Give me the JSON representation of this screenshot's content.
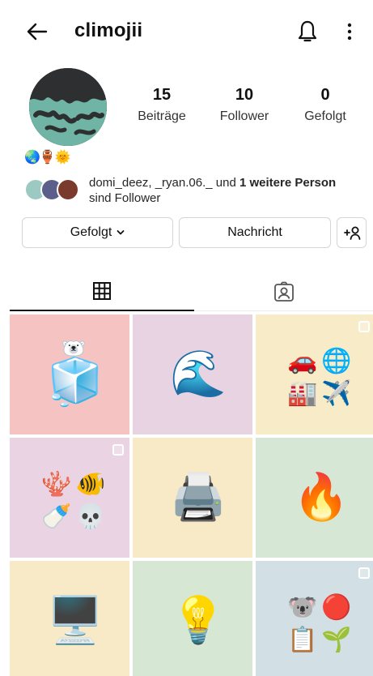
{
  "header": {
    "username": "climojii",
    "back_icon": "arrow-left-icon",
    "notification_icon": "bell-icon",
    "menu_icon": "more-vertical-icon"
  },
  "profile": {
    "stats": {
      "posts": {
        "value": "15",
        "label": "Beiträge"
      },
      "followers": {
        "value": "10",
        "label": "Follower"
      },
      "following": {
        "value": "0",
        "label": "Gefolgt"
      }
    },
    "bio": "🌏🏺🌞",
    "followed_by": {
      "names": "domi_deez, _ryan.06._",
      "connector": " und ",
      "more": "1 weitere Person",
      "suffix": "sind Follower"
    }
  },
  "actions": {
    "following_label": "Gefolgt",
    "message_label": "Nachricht",
    "add_user_icon": "person-add-icon"
  },
  "tabs": [
    {
      "name": "posts-grid",
      "icon": "grid-icon",
      "active": true
    },
    {
      "name": "tagged",
      "icon": "tagged-person-icon",
      "active": false
    }
  ],
  "posts": [
    {
      "bg": "#f6c3c3",
      "emojis": [
        "🐻‍❄️",
        "🧊"
      ],
      "multi": false
    },
    {
      "bg": "#e8d3e3",
      "emojis": [
        "🌊"
      ],
      "multi": false
    },
    {
      "bg": "#f7ebc8",
      "emojis": [
        "🚗",
        "🌐",
        "🏭",
        "✈️"
      ],
      "multi": true
    },
    {
      "bg": "#ead3e3",
      "emojis": [
        "🪸",
        "🐠",
        "🍼",
        "💀"
      ],
      "multi": true
    },
    {
      "bg": "#f8eac6",
      "emojis": [
        "🖨️"
      ],
      "multi": false
    },
    {
      "bg": "#d6e8d5",
      "emojis": [
        "🔥"
      ],
      "multi": false
    },
    {
      "bg": "#f8eac6",
      "emojis": [
        "🖥️"
      ],
      "multi": false
    },
    {
      "bg": "#d6e8d3",
      "emojis": [
        "💡"
      ],
      "multi": false
    },
    {
      "bg": "#d2e0e5",
      "emojis": [
        "🐨",
        "🔴",
        "📋",
        "🌱"
      ],
      "multi": true
    }
  ]
}
